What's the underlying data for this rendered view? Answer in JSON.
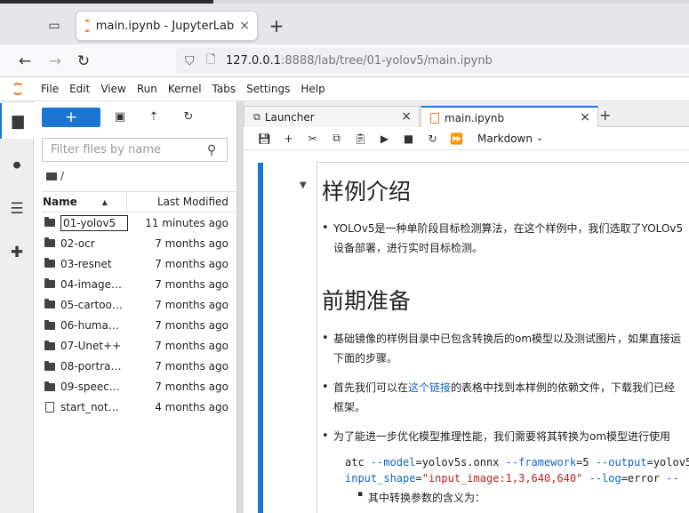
{
  "browser": {
    "tab_title": "main.ipynb - JupyterLab",
    "close_glyph": "×",
    "newtab_glyph": "+",
    "url_host": "127.0.0.1",
    "url_rest": ":8888/lab/tree/01-yolov5/main.ipynb"
  },
  "menubar": {
    "items": [
      "File",
      "Edit",
      "View",
      "Run",
      "Kernel",
      "Tabs",
      "Settings",
      "Help"
    ]
  },
  "filebrowser": {
    "new_label": "+",
    "search_placeholder": "Filter files by name",
    "breadcrumb": "/",
    "col_name": "Name",
    "col_modified": "Last Modified",
    "files": [
      {
        "name": "01-yolov5",
        "modified": "11 minutes ago",
        "type": "folder"
      },
      {
        "name": "02-ocr",
        "modified": "7 months ago",
        "type": "folder"
      },
      {
        "name": "03-resnet",
        "modified": "7 months ago",
        "type": "folder"
      },
      {
        "name": "04-image…",
        "modified": "7 months ago",
        "type": "folder"
      },
      {
        "name": "05-cartoo…",
        "modified": "7 months ago",
        "type": "folder"
      },
      {
        "name": "06-huma…",
        "modified": "7 months ago",
        "type": "folder"
      },
      {
        "name": "07-Unet++",
        "modified": "7 months ago",
        "type": "folder"
      },
      {
        "name": "08-portra…",
        "modified": "7 months ago",
        "type": "folder"
      },
      {
        "name": "09-speec…",
        "modified": "7 months ago",
        "type": "folder"
      },
      {
        "name": "start_not…",
        "modified": "4 months ago",
        "type": "notebook"
      }
    ]
  },
  "dock": {
    "tab_launcher": "Launcher",
    "tab_notebook": "main.ipynb",
    "close_glyph": "×",
    "add_glyph": "+"
  },
  "nb_toolbar": {
    "cell_type": "Markdown"
  },
  "notebook": {
    "h1_example": "样例介绍",
    "p1": "YOLOv5是一种单阶段目标检测算法，在这个样例中，我们选取了YOLOv5",
    "p1b": "设备部署，进行实时目标检测。",
    "h1_prep": "前期准备",
    "p2": "基础镜像的样例目录中已包含转换后的om模型以及测试图片，如果直接运",
    "p2b": "下面的步骤。",
    "p3_pre": "首先我们可以在",
    "p3_link": "这个链接",
    "p3_post": "的表格中找到本样例的依赖文件，下载我们已经",
    "p3b": "框架。",
    "p4": "为了能进一步优化模型推理性能，我们需要将其转换为om模型进行使用",
    "code1_cmd": "atc ",
    "code1_a1": "--model",
    "code1_v1": "=yolov5s.onnx ",
    "code1_a2": "--framework",
    "code1_v2": "=5 ",
    "code1_a3": "--output",
    "code1_v3": "=yolov5",
    "code2_a1": "input_shape",
    "code2_v1": "=",
    "code2_s1": "\"input_image:1,3,640,640\"",
    "code2_v1b": " ",
    "code2_a2": "--log",
    "code2_v2": "=error ",
    "code2_a3": "--",
    "sub1": "其中转换参数的含义为："
  }
}
